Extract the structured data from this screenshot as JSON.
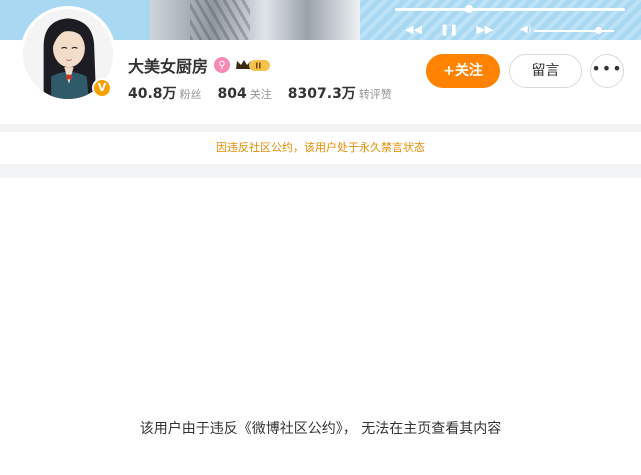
{
  "cover": {
    "progress_fraction": 0.32,
    "volume_fraction": 0.8,
    "controls": [
      "prev-icon",
      "pause-icon",
      "next-icon",
      "volume-icon"
    ]
  },
  "profile": {
    "username": "大美女厨房",
    "verify_badge": "V",
    "stats": {
      "followers_num": "40.8万",
      "followers_label": "粉丝",
      "following_num": "804",
      "following_label": "关注",
      "interactions_num": "8307.3万",
      "interactions_label": "转评赞"
    },
    "buttons": {
      "follow_label": "+关注",
      "message_label": "留言",
      "more_label": "•••"
    },
    "colors": {
      "accent": "#ff8200",
      "badge": "#f6a100",
      "level_icon": "#f58ab4"
    }
  },
  "notice": {
    "text": "因违反社区公约，该用户处于永久禁言状态"
  },
  "content": {
    "empty_message": "该用户由于违反《微博社区公约》， 无法在主页查看其内容"
  }
}
